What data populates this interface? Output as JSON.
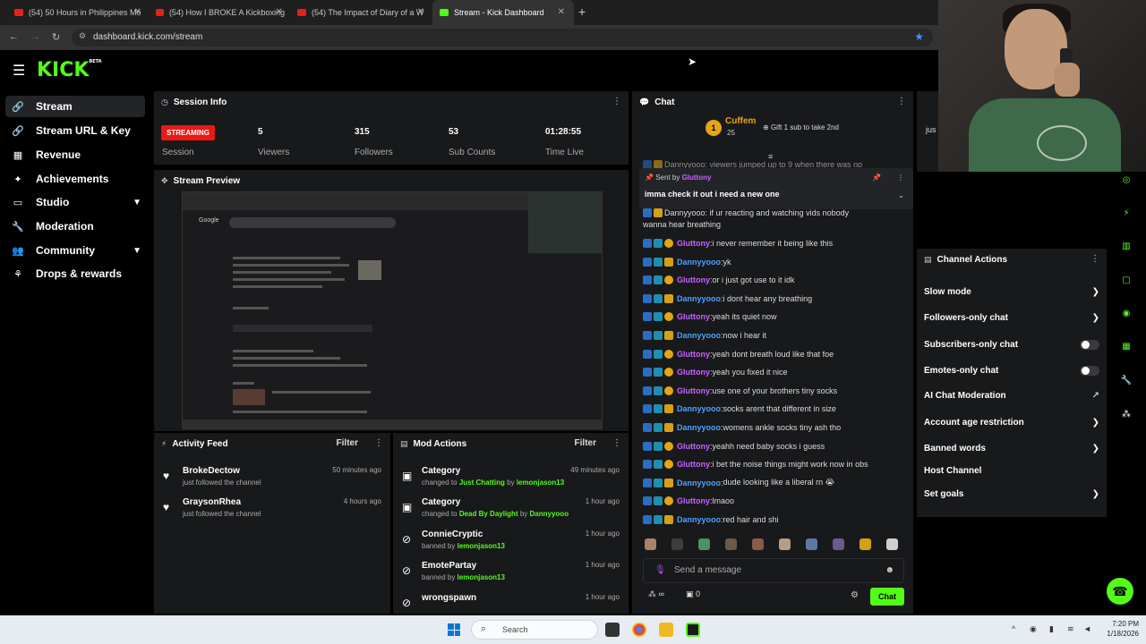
{
  "browser": {
    "tabs": [
      {
        "title": "(54) 50 Hours in Philippines Mo",
        "type": "yt"
      },
      {
        "title": "(54) How I BROKE A Kickboxing",
        "type": "yt"
      },
      {
        "title": "(54) The Impact of Diary of a W",
        "type": "yt"
      },
      {
        "title": "Stream - Kick Dashboard",
        "type": "kick"
      }
    ],
    "url": "dashboard.kick.com/stream"
  },
  "brand": {
    "logo": "KICK",
    "tag": "BETA"
  },
  "sidebar": {
    "items": [
      {
        "label": "Stream",
        "icon": "link-icon"
      },
      {
        "label": "Stream URL & Key",
        "icon": "link-icon"
      },
      {
        "label": "Revenue",
        "icon": "chart-icon"
      },
      {
        "label": "Achievements",
        "icon": "star-icon"
      },
      {
        "label": "Studio",
        "icon": "studio-icon"
      },
      {
        "label": "Moderation",
        "icon": "wrench-icon"
      },
      {
        "label": "Community",
        "icon": "people-icon"
      },
      {
        "label": "Drops & rewards",
        "icon": "gift-icon"
      }
    ]
  },
  "session": {
    "title": "Session Info",
    "status_badge": "STREAMING",
    "status_label": "Session",
    "stats": [
      {
        "value": "5",
        "label": "Viewers"
      },
      {
        "value": "315",
        "label": "Followers"
      },
      {
        "value": "53",
        "label": "Sub Counts"
      },
      {
        "value": "01:28:55",
        "label": "Time Live"
      }
    ]
  },
  "preview": {
    "title": "Stream Preview"
  },
  "activity": {
    "title": "Activity Feed",
    "filter": "Filter",
    "items": [
      {
        "name": "BrokeDectow",
        "sub": "just followed the channel",
        "time": "50 minutes ago"
      },
      {
        "name": "GraysonRhea",
        "sub": "just followed the channel",
        "time": "4 hours ago"
      }
    ]
  },
  "mod_actions": {
    "title": "Mod Actions",
    "filter": "Filter",
    "items": [
      {
        "name": "Category",
        "pre": "changed to ",
        "hl1": "Just Chatting",
        "mid": " by ",
        "hl2": "lemonjason13",
        "time": "49 minutes ago",
        "icon": "category-icon"
      },
      {
        "name": "Category",
        "pre": "changed to ",
        "hl1": "Dead By Daylight",
        "mid": " by ",
        "hl2": "Dannyyooo",
        "time": "1 hour ago",
        "icon": "category-icon"
      },
      {
        "name": "ConnieCryptic",
        "pre": "banned by ",
        "hl1": "",
        "mid": "",
        "hl2": "lemonjason13",
        "time": "1 hour ago",
        "icon": "ban-icon"
      },
      {
        "name": "EmotePartay",
        "pre": "banned by ",
        "hl1": "",
        "mid": "",
        "hl2": "lemonjason13",
        "time": "1 hour ago",
        "icon": "ban-icon"
      },
      {
        "name": "wrongspawn",
        "pre": "",
        "hl1": "",
        "mid": "",
        "hl2": "",
        "time": "1 hour ago",
        "icon": "ban-icon"
      }
    ]
  },
  "chat": {
    "title": "Chat",
    "gift": {
      "user": "Cuffem",
      "count": "25",
      "cta": "Gift 1 sub to take 2nd",
      "rank": "1"
    },
    "pinned": {
      "sent_by_label": "Sent by",
      "user": "Gluttony",
      "text": "imma check it out i need a new one"
    },
    "partial_top": "Dannyyooo: viewers jumped up to 9 when there was no",
    "partial_under_pin": "Dannyyooo: if ur reacting and watching vids nobody",
    "partial_under_pin2": "wanna hear breathing",
    "messages": [
      {
        "user": "Gluttony",
        "text": "i never remember it being like this"
      },
      {
        "user": "Dannyyooo",
        "text": "yk"
      },
      {
        "user": "Gluttony",
        "text": "or i just got use to it idk"
      },
      {
        "user": "Dannyyooo",
        "text": "i dont hear any breathing"
      },
      {
        "user": "Gluttony",
        "text": "yeah its quiet now"
      },
      {
        "user": "Dannyyooo",
        "text": "now i hear it"
      },
      {
        "user": "Gluttony",
        "text": "yeah dont breath loud like that foe"
      },
      {
        "user": "Gluttony",
        "text": "yeah you fixed it nice"
      },
      {
        "user": "Gluttony",
        "text": "use one of your brothers tiny socks"
      },
      {
        "user": "Dannyyooo",
        "text": "socks arent that different in size"
      },
      {
        "user": "Dannyyooo",
        "text": "womens ankle socks tiny ash tho"
      },
      {
        "user": "Gluttony",
        "text": "yeahh need baby socks i guess"
      },
      {
        "user": "Gluttony",
        "text": "i bet the noise things might work now in obs"
      },
      {
        "user": "Dannyyooo",
        "text": "dude looking like a liberal rn 😭"
      },
      {
        "user": "Gluttony",
        "text": "lmaoo"
      },
      {
        "user": "Dannyyooo",
        "text": "red hair and shi"
      }
    ],
    "input_placeholder": "Send a message",
    "infinity_label": "∞",
    "gift_count": "0",
    "send_label": "Chat"
  },
  "channel_actions": {
    "title": "Channel Actions",
    "items": [
      {
        "label": "Slow mode",
        "control": "arrow"
      },
      {
        "label": "Followers-only chat",
        "control": "arrow"
      },
      {
        "label": "Subscribers-only chat",
        "control": "toggle"
      },
      {
        "label": "Emotes-only chat",
        "control": "toggle"
      },
      {
        "label": "AI Chat Moderation",
        "control": "external"
      },
      {
        "label": "Account age restriction",
        "control": "arrow"
      },
      {
        "label": "Banned words",
        "control": "arrow"
      },
      {
        "label": "Host Channel",
        "control": "none"
      },
      {
        "label": "Set goals",
        "control": "arrow"
      }
    ]
  },
  "partial_panel": {
    "label": "jus"
  },
  "taskbar": {
    "search_placeholder": "Search",
    "time": "7:20 PM",
    "date": "1/18/2026"
  },
  "colors": {
    "accent": "#53fc18",
    "streaming": "#e91916",
    "panel": "#18191b",
    "user_gluttony": "#c463ff",
    "user_danny": "#4aa3ff"
  }
}
